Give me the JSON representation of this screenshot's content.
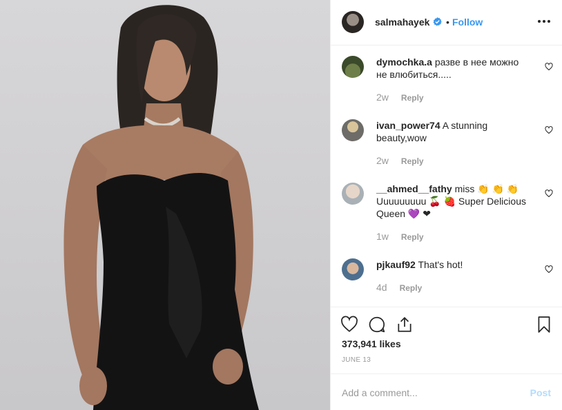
{
  "post": {
    "author": "salmahayek",
    "separator": "•",
    "follow_label": "Follow",
    "verified_icon": "verified-badge-icon",
    "more_icon": "more-options-icon"
  },
  "comments": [
    {
      "username": "dymochka.a",
      "line1": "разве в нее можно",
      "line2": "не влюбиться.....",
      "line3": "",
      "age": "2w",
      "reply": "Reply"
    },
    {
      "username": "ivan_power74",
      "line1": "A stunning",
      "line2": "beauty,wow",
      "line3": "",
      "age": "2w",
      "reply": "Reply"
    },
    {
      "username": "__ahmed__fathy",
      "line1": "miss 👏 👏 👏",
      "line2": "Uuuuuuuuu 🍒 🍓 Super Delicious",
      "line3": "Queen 💜 ❤",
      "age": "1w",
      "reply": "Reply"
    },
    {
      "username": "pjkauf92",
      "line1": "That's hot!",
      "line2": "",
      "line3": "",
      "age": "4d",
      "reply": "Reply"
    }
  ],
  "stats": {
    "likes": "373,941 likes",
    "date": "JUNE 13"
  },
  "composer": {
    "placeholder": "Add a comment...",
    "post_label": "Post"
  },
  "colors": {
    "accent": "#3897f0",
    "muted": "#999999",
    "post_disabled": "#b3dbff",
    "text": "#262626"
  }
}
